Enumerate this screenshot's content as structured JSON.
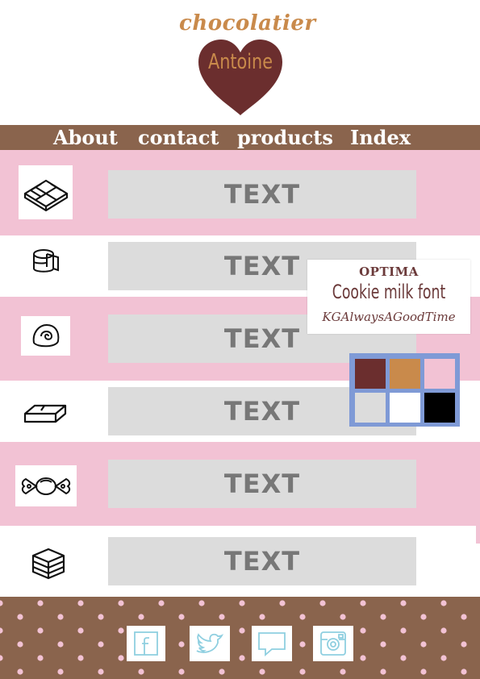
{
  "brand": {
    "top": "chocolatier",
    "name": "Antoine"
  },
  "nav": [
    {
      "label": "About"
    },
    {
      "label": "contact"
    },
    {
      "label": "products"
    },
    {
      "label": "Index"
    }
  ],
  "rows": [
    {
      "icon": "chocolate-bar-grid-icon",
      "text": "TEXT"
    },
    {
      "icon": "cheese-wheel-icon",
      "text": "TEXT"
    },
    {
      "icon": "bonbon-swirl-icon",
      "text": "TEXT"
    },
    {
      "icon": "chocolate-piece-icon",
      "text": "TEXT"
    },
    {
      "icon": "wrapped-candy-icon",
      "text": "TEXT"
    },
    {
      "icon": "layered-cake-icon",
      "text": "TEXT"
    }
  ],
  "font_card": {
    "line1": "OPTIMA",
    "line2": "Cookie milk font",
    "line3": "KGAlwaysAGoodTime"
  },
  "palette": [
    "#6b2e2e",
    "#c98a4b",
    "#f2c2d4",
    "#dcdcdc",
    "#ffffff",
    "#000000"
  ],
  "colors": {
    "nav_brown": "#8a644d",
    "pink": "#f2c2d4",
    "heart": "#6b2e2e",
    "accent": "#c98a4b",
    "text_box": "#dcdcdc",
    "palette_border": "#7f9ad6",
    "social_icon": "#8fcfe0"
  },
  "social": [
    {
      "icon": "facebook-icon"
    },
    {
      "icon": "twitter-icon"
    },
    {
      "icon": "chat-icon"
    },
    {
      "icon": "instagram-icon"
    }
  ]
}
